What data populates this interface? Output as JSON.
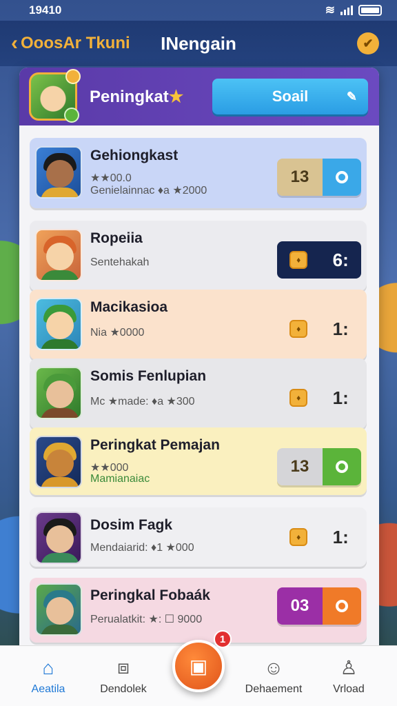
{
  "status_bar": {
    "time": "19410"
  },
  "header": {
    "back_label": "OoosAr Tkuni",
    "title": "INengain"
  },
  "panel": {
    "title": "Peningkat",
    "title_star": "★",
    "soal_label": "Soail",
    "soal_icon": "✎"
  },
  "rows": [
    {
      "name": "Gehiongkast",
      "line1": "★★00.0",
      "line2": "Genielainnac ♦a ★2000",
      "score": "13",
      "bg": "#c9d6f7",
      "pill_num_bg": "#d9c392",
      "pill_btn_bg": "#3aa8e8"
    },
    {
      "name": "Ropeiia",
      "line1": "Sentehakah",
      "line2": "",
      "rank": "6:",
      "bg": "#ebebef"
    },
    {
      "name": "Macikasioa",
      "line1": "Nia ★0000",
      "line2": "",
      "rank": "1:",
      "bg": "#fbe2cc"
    },
    {
      "name": "Somis Fenlupian",
      "line1": "Mc ★made: ♦a ★300",
      "line2": "",
      "rank": "1:",
      "bg": "#e7e7ea"
    },
    {
      "name": "Peringkat Pemajan",
      "line1": "★★000",
      "line2": "Mamianaiac",
      "score": "13",
      "bg": "#faf0bf",
      "pill_num_bg": "#d5d5d8",
      "pill_btn_bg": "#5bb43a"
    },
    {
      "name": "Dosim Fagk",
      "line1": "Mendaiarid: ♦1 ★000",
      "line2": "",
      "rank": "1:",
      "bg": "#efeff2"
    },
    {
      "name": "Peringkal Fobaák",
      "line1": "Perualatkit: ★: ☐ 9000",
      "line2": "",
      "score": "03",
      "bg": "#f5d9e2",
      "pill_num_bg": "#9b2fa6",
      "pill_btn_bg": "#f07a28"
    }
  ],
  "nav": {
    "home": "Aeatila",
    "items2": "Dendolek",
    "items4": "Dehaement",
    "profile": "Vrload"
  },
  "fab": {
    "badge": "1"
  }
}
